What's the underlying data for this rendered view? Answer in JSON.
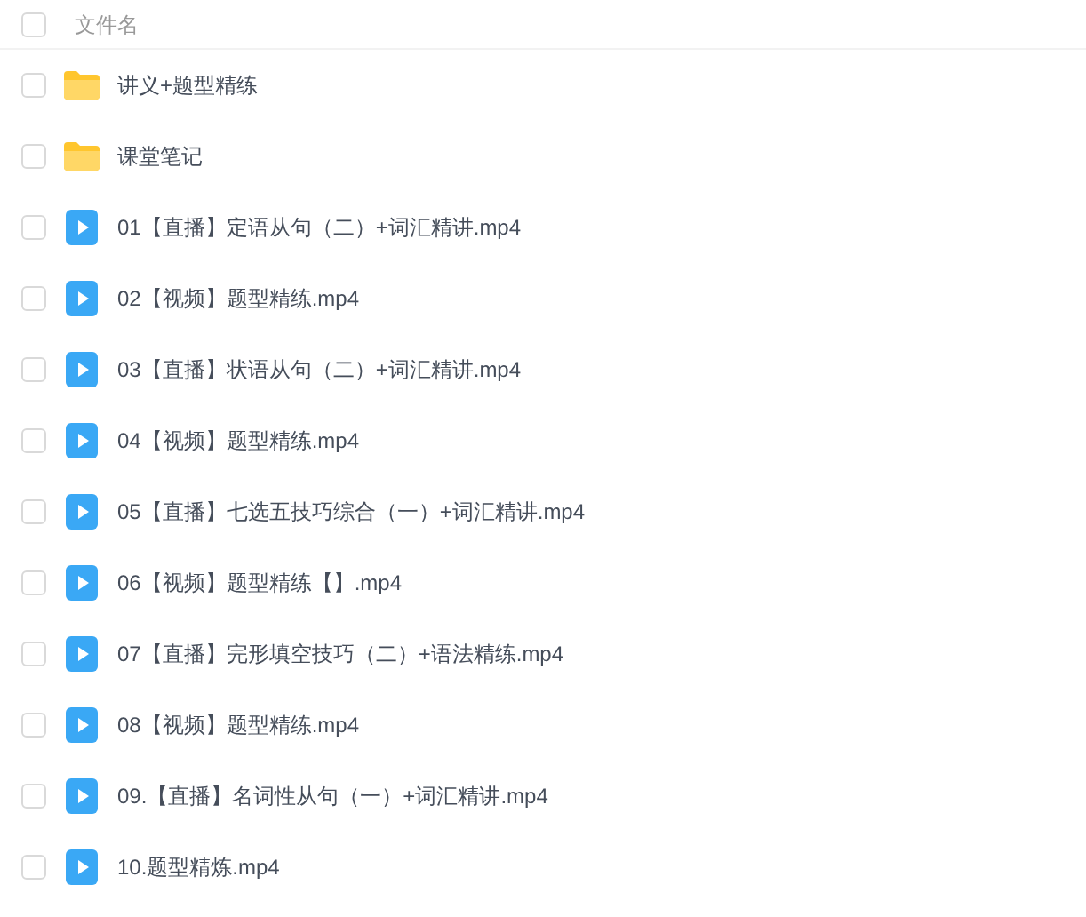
{
  "header": {
    "label": "文件名",
    "checked": false
  },
  "files": [
    {
      "kind": "folder",
      "name": "讲义+题型精练",
      "checked": false
    },
    {
      "kind": "folder",
      "name": "课堂笔记",
      "checked": false
    },
    {
      "kind": "video",
      "name": "01【直播】定语从句（二）+词汇精讲.mp4",
      "checked": false
    },
    {
      "kind": "video",
      "name": "02【视频】题型精练.mp4",
      "checked": false
    },
    {
      "kind": "video",
      "name": "03【直播】状语从句（二）+词汇精讲.mp4",
      "checked": false
    },
    {
      "kind": "video",
      "name": "04【视频】题型精练.mp4",
      "checked": false
    },
    {
      "kind": "video",
      "name": "05【直播】七选五技巧综合（一）+词汇精讲.mp4",
      "checked": false
    },
    {
      "kind": "video",
      "name": "06【视频】题型精练【】.mp4",
      "checked": false
    },
    {
      "kind": "video",
      "name": "07【直播】完形填空技巧（二）+语法精练.mp4",
      "checked": false
    },
    {
      "kind": "video",
      "name": "08【视频】题型精练.mp4",
      "checked": false
    },
    {
      "kind": "video",
      "name": "09.【直播】名词性从句（一）+词汇精讲.mp4",
      "checked": false
    },
    {
      "kind": "video",
      "name": "10.题型精炼.mp4",
      "checked": false
    }
  ]
}
